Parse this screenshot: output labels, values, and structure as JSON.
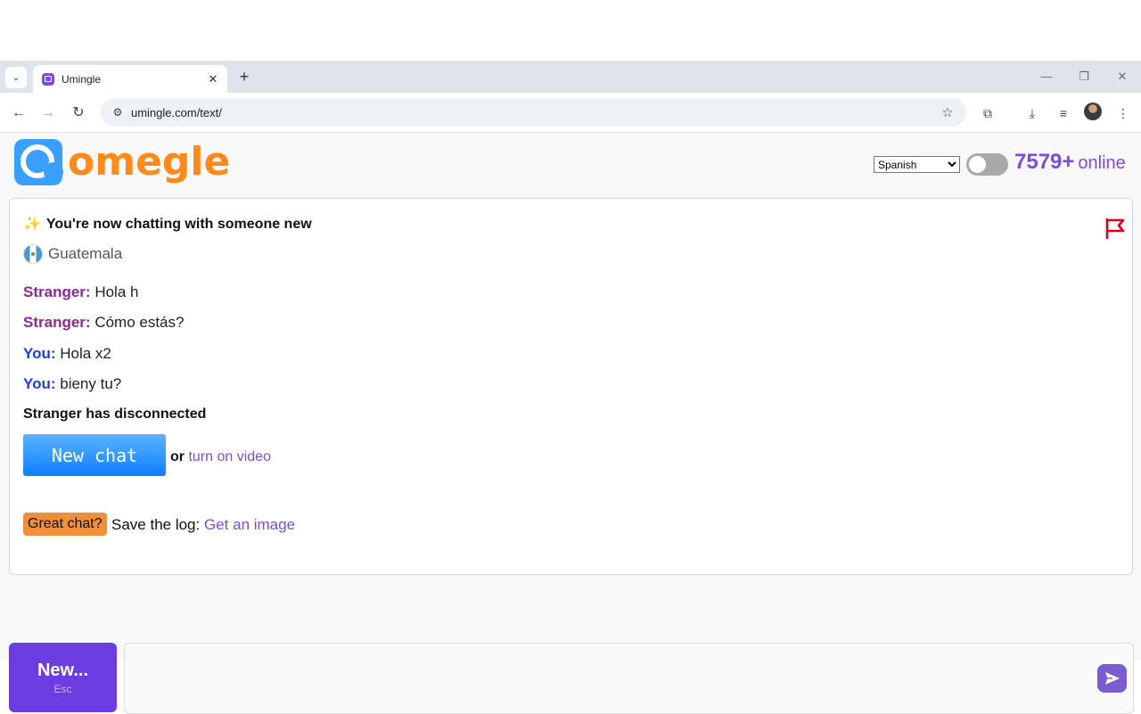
{
  "browser": {
    "tab_title": "Umingle",
    "url": "umingle.com/text/",
    "dropdown_glyph": "⌄",
    "close_glyph": "✕",
    "new_tab_glyph": "+",
    "minimize_glyph": "—",
    "restore_glyph": "❐",
    "window_close_glyph": "✕",
    "back_glyph": "←",
    "forward_glyph": "→",
    "reload_glyph": "↻",
    "site_info_glyph": "⚙",
    "star_glyph": "☆",
    "extensions_glyph": "⧉",
    "download_glyph": "⤓",
    "media_glyph": "≡",
    "menu_glyph": "⋮"
  },
  "header": {
    "logo_text": "omegle",
    "language_options": [
      "Spanish"
    ],
    "language_selected": "Spanish",
    "online_count": "7579+",
    "online_label": "online"
  },
  "chat": {
    "status": "You're now chatting with someone new",
    "sparkle_glyph": "✨",
    "country": "Guatemala",
    "messages": [
      {
        "who": "Stranger:",
        "text": "Hola h"
      },
      {
        "who": "Stranger:",
        "text": "Cómo estás?"
      },
      {
        "who": "You:",
        "text": "Hola x2"
      },
      {
        "who": "You:",
        "text": "bieny tu?"
      }
    ],
    "disconnected": "Stranger has disconnected",
    "new_chat_label": "New chat",
    "or_text": "or",
    "video_link": "turn on video",
    "great_chat_badge": "Great chat?",
    "save_log_text": "Save the log:",
    "image_link": "Get an image"
  },
  "bottom": {
    "new_label": "New...",
    "new_hint": "Esc",
    "message_value": ""
  },
  "colors": {
    "accent_purple": "#6c3ce3",
    "logo_orange": "#ff8a1a",
    "logo_blue": "#3aa0ff",
    "stranger": "#8a2b8f",
    "you": "#1a3de6",
    "report_flag": "#e0001b"
  }
}
